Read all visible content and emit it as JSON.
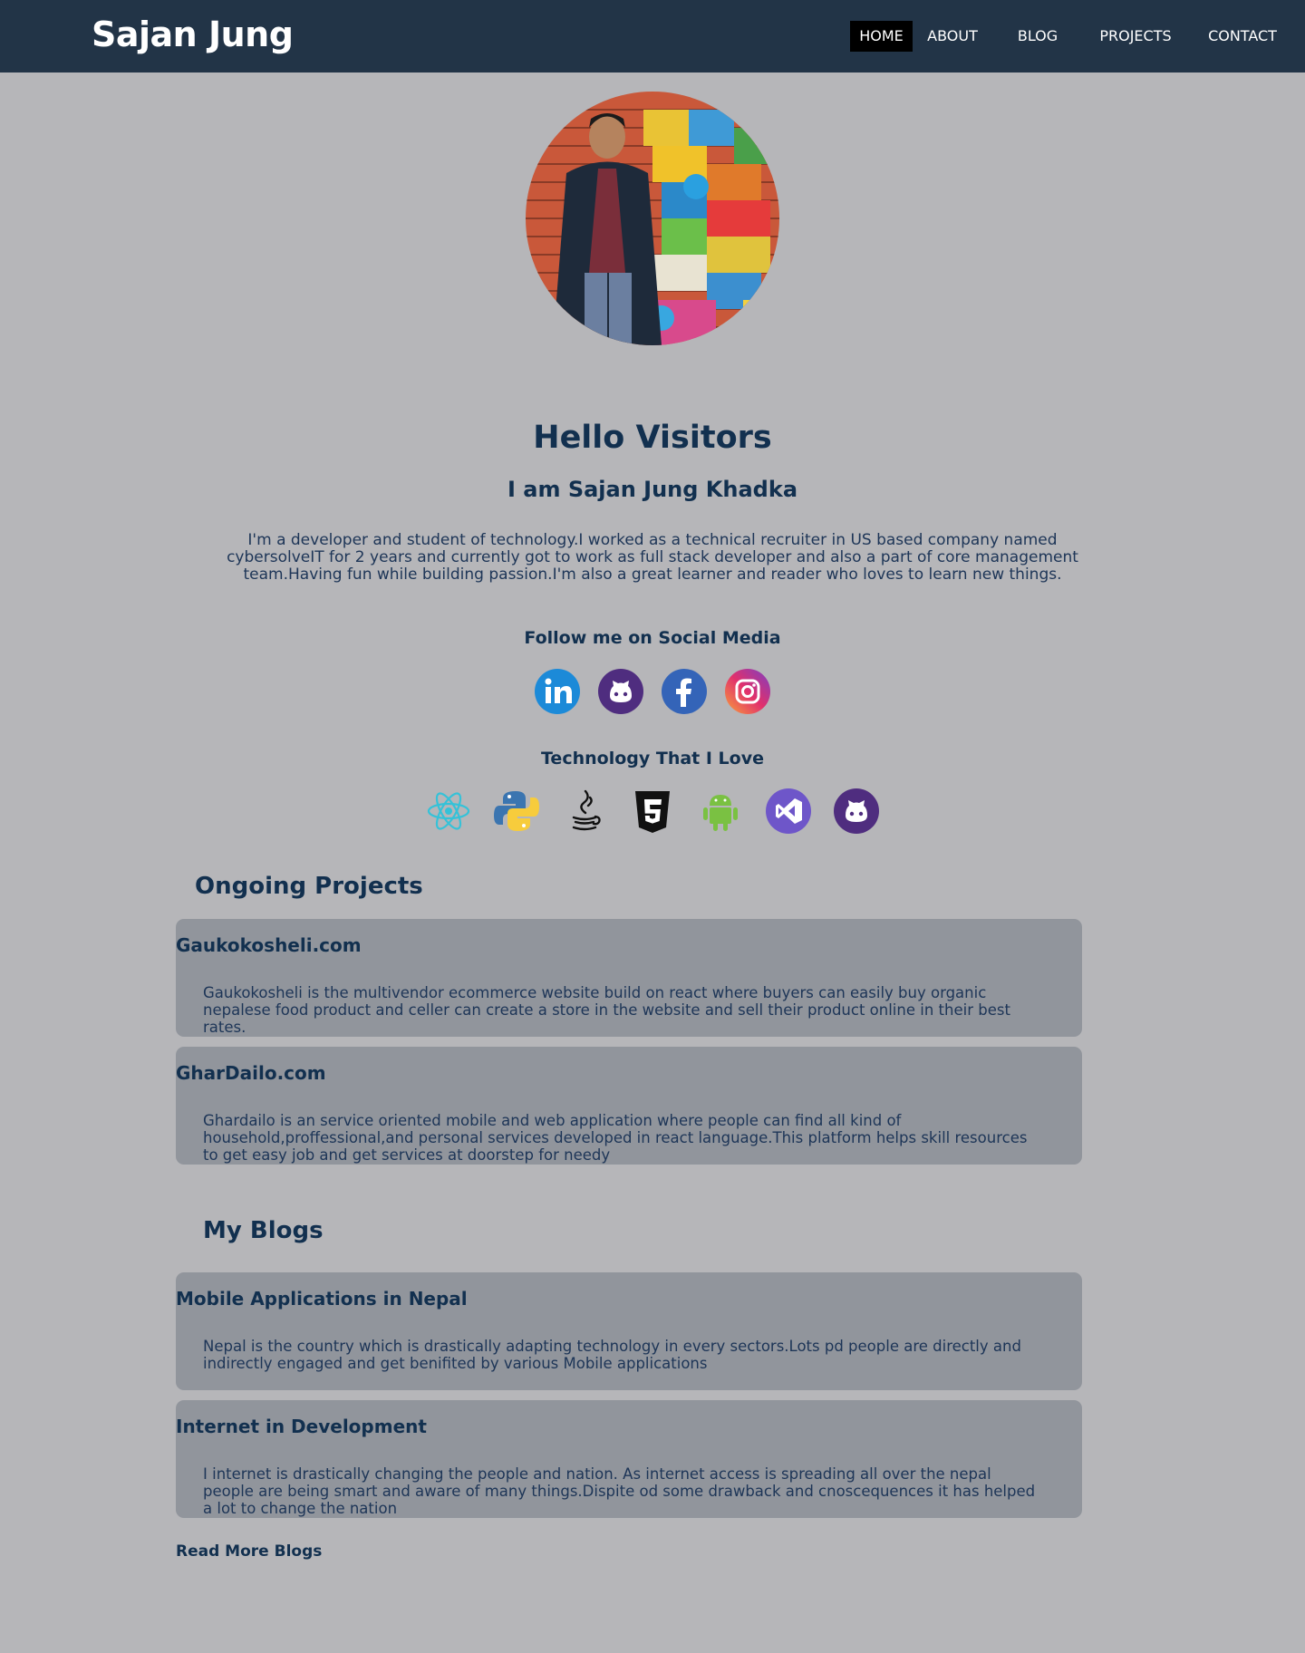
{
  "header": {
    "brand": "Sajan Jung",
    "nav": [
      "HOME",
      "ABOUT",
      "BLOG",
      "PROJECTS",
      "CONTACT"
    ],
    "active_item": "HOME"
  },
  "hero": {
    "greeting": "Hello Visitors",
    "name_line": "I am Sajan Jung Khadka",
    "bio": "I'm a developer and student of technology.I worked as a technical recruiter in US based company named cybersolveIT for 2 years and currently got to work as full stack developer and also a part of core management team.Having fun while building passion.I'm also a great learner and reader who loves to learn new things."
  },
  "social": {
    "heading": "Follow me on Social Media",
    "icons": [
      "linkedin-icon",
      "github-icon",
      "facebook-icon",
      "instagram-icon"
    ]
  },
  "technology": {
    "heading": "Technology That I Love",
    "icons": [
      "react-icon",
      "python-icon",
      "java-icon",
      "html5-icon",
      "android-icon",
      "visual-studio-icon",
      "github-icon"
    ]
  },
  "projects": {
    "heading": "Ongoing Projects",
    "items": [
      {
        "title": "Gaukokosheli.com",
        "description": "Gaukokosheli is the multivendor ecommerce website build on react where buyers can easily buy organic nepalese food product and celler can create a store in the website and sell their product online in their best rates."
      },
      {
        "title": "GharDailo.com",
        "description": "Ghardailo is an service oriented mobile and web application where people can find all kind of household,proffessional,and personal services developed in react language.This platform helps skill resources to get easy job and get services at doorstep for needy"
      }
    ]
  },
  "blogs": {
    "heading": "My Blogs",
    "items": [
      {
        "title": "Mobile Applications in Nepal",
        "description": "Nepal is the country which is drastically adapting technology in every sectors.Lots pd people are directly and indirectly engaged and get benifited by various Mobile applications"
      },
      {
        "title": "Internet in Development",
        "description": "I internet is drastically changing the people and nation. As internet access is spreading all over the nepal people are being smart and aware of many things.Dispite od some drawback and cnoscequences it has helped a lot to change the nation"
      }
    ],
    "read_more": "Read More Blogs"
  },
  "colors": {
    "nav_bg": "#223447",
    "page_bg": "#b6b6b9",
    "card_bg": "#91959c",
    "text": "#12304f"
  }
}
